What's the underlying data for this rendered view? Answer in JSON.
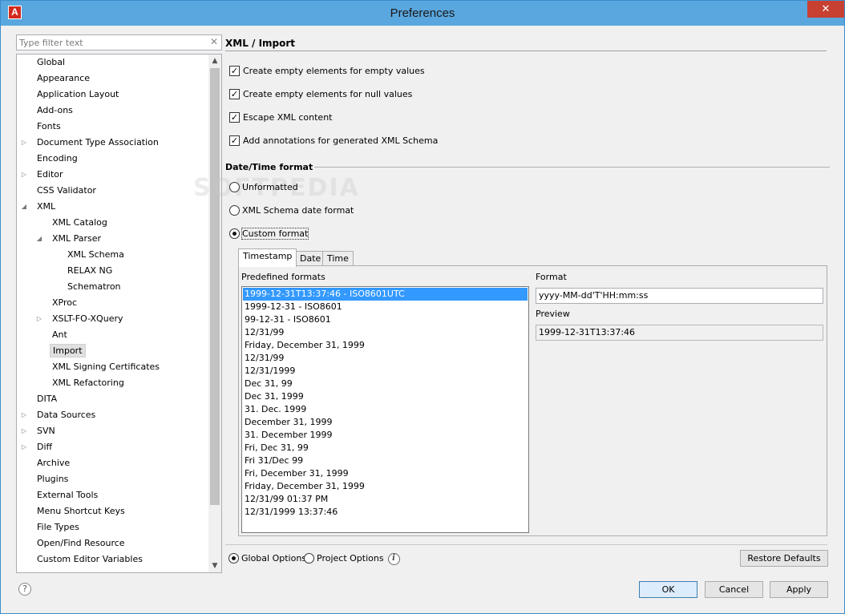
{
  "window": {
    "title": "Preferences",
    "app_icon": "A",
    "close_glyph": "✕"
  },
  "filter": {
    "placeholder": "Type filter text",
    "clear_glyph": "✕"
  },
  "tree": {
    "items": [
      {
        "label": "Global",
        "level": 0,
        "expander": "none"
      },
      {
        "label": "Appearance",
        "level": 0,
        "expander": "none"
      },
      {
        "label": "Application Layout",
        "level": 0,
        "expander": "none"
      },
      {
        "label": "Add-ons",
        "level": 0,
        "expander": "none"
      },
      {
        "label": "Fonts",
        "level": 0,
        "expander": "none"
      },
      {
        "label": "Document Type Association",
        "level": 0,
        "expander": "collapsed"
      },
      {
        "label": "Encoding",
        "level": 0,
        "expander": "none"
      },
      {
        "label": "Editor",
        "level": 0,
        "expander": "collapsed"
      },
      {
        "label": "CSS Validator",
        "level": 0,
        "expander": "none"
      },
      {
        "label": "XML",
        "level": 0,
        "expander": "expanded"
      },
      {
        "label": "XML Catalog",
        "level": 1,
        "expander": "none"
      },
      {
        "label": "XML Parser",
        "level": 1,
        "expander": "expanded"
      },
      {
        "label": "XML Schema",
        "level": 2,
        "expander": "none"
      },
      {
        "label": "RELAX NG",
        "level": 2,
        "expander": "none"
      },
      {
        "label": "Schematron",
        "level": 2,
        "expander": "none"
      },
      {
        "label": "XProc",
        "level": 1,
        "expander": "none"
      },
      {
        "label": "XSLT-FO-XQuery",
        "level": 1,
        "expander": "collapsed"
      },
      {
        "label": "Ant",
        "level": 1,
        "expander": "none"
      },
      {
        "label": "Import",
        "level": 1,
        "expander": "none",
        "selected": true
      },
      {
        "label": "XML Signing Certificates",
        "level": 1,
        "expander": "none"
      },
      {
        "label": "XML Refactoring",
        "level": 1,
        "expander": "none"
      },
      {
        "label": "DITA",
        "level": 0,
        "expander": "none"
      },
      {
        "label": "Data Sources",
        "level": 0,
        "expander": "collapsed"
      },
      {
        "label": "SVN",
        "level": 0,
        "expander": "collapsed"
      },
      {
        "label": "Diff",
        "level": 0,
        "expander": "collapsed"
      },
      {
        "label": "Archive",
        "level": 0,
        "expander": "none"
      },
      {
        "label": "Plugins",
        "level": 0,
        "expander": "none"
      },
      {
        "label": "External Tools",
        "level": 0,
        "expander": "none"
      },
      {
        "label": "Menu Shortcut Keys",
        "level": 0,
        "expander": "none"
      },
      {
        "label": "File Types",
        "level": 0,
        "expander": "none"
      },
      {
        "label": "Open/Find Resource",
        "level": 0,
        "expander": "none"
      },
      {
        "label": "Custom Editor Variables",
        "level": 0,
        "expander": "none"
      }
    ]
  },
  "page": {
    "title": "XML / Import",
    "checkboxes": [
      {
        "label": "Create empty elements for empty values",
        "checked": true
      },
      {
        "label": "Create empty elements for null values",
        "checked": true
      },
      {
        "label": "Escape XML content",
        "checked": true
      },
      {
        "label": "Add annotations for generated XML Schema",
        "checked": true
      }
    ],
    "datetime": {
      "section_title": "Date/Time format",
      "options": [
        {
          "label": "Unformatted",
          "selected": false
        },
        {
          "label": "XML Schema date format",
          "selected": false
        },
        {
          "label": "Custom format",
          "selected": true
        }
      ],
      "tabs": [
        "Timestamp",
        "Date",
        "Time"
      ],
      "active_tab": "Timestamp",
      "predefined_label": "Predefined formats",
      "predefined_formats": [
        "1999-12-31T13:37:46 - ISO8601UTC",
        "1999-12-31 - ISO8601",
        "99-12-31 - ISO8601",
        "12/31/99",
        "Friday, December 31, 1999",
        "12/31/99",
        "12/31/1999",
        "Dec 31, 99",
        "Dec 31, 1999",
        "31. Dec. 1999",
        "December 31, 1999",
        "31. December 1999",
        "Fri, Dec 31, 99",
        "Fri 31/Dec 99",
        "Fri, December 31, 1999",
        "Friday, December 31, 1999",
        "12/31/99 01:37 PM",
        "12/31/1999 13:37:46"
      ],
      "selected_format_index": 0,
      "format_label": "Format",
      "format_value": "yyyy-MM-dd'T'HH:mm:ss",
      "preview_label": "Preview",
      "preview_value": "1999-12-31T13:37:46"
    }
  },
  "footer": {
    "global_options": "Global Options",
    "project_options": "Project Options",
    "info_glyph": "i",
    "restore_defaults": "Restore Defaults",
    "ok": "OK",
    "cancel": "Cancel",
    "apply": "Apply",
    "help_glyph": "?"
  },
  "watermark": "SOFTPEDIA"
}
